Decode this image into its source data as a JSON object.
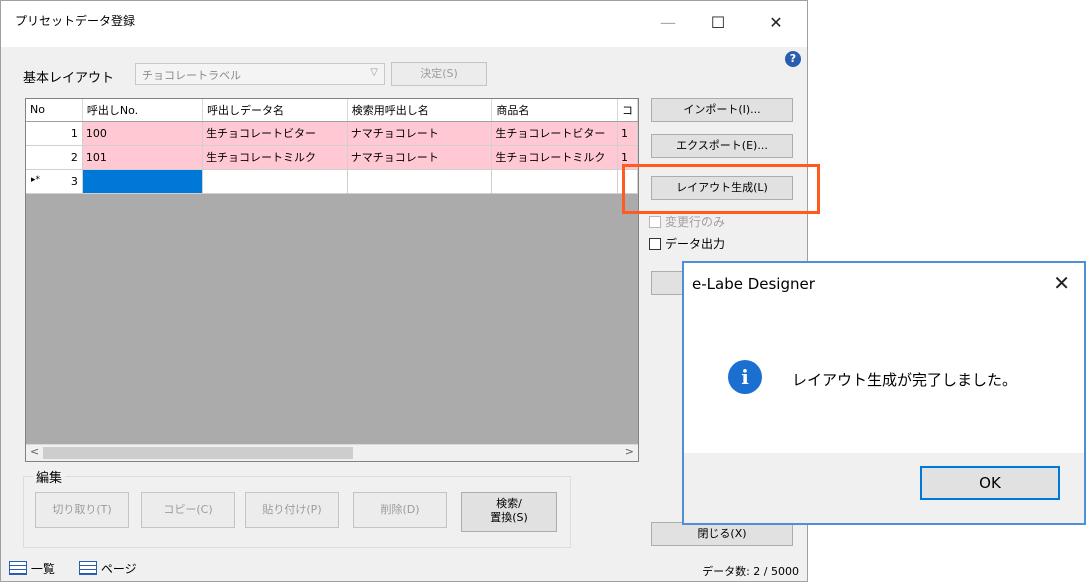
{
  "window": {
    "title": "プリセットデータ登録",
    "minimize": "—",
    "maximize": "☐",
    "close": "✕",
    "help": "?"
  },
  "layout": {
    "label": "基本レイアウト",
    "selected": "チョコレートラベル",
    "decide_button": "決定(S)"
  },
  "grid": {
    "columns": [
      "No",
      "呼出しNo.",
      "呼出しデータ名",
      "検索用呼出し名",
      "商品名",
      "コ"
    ],
    "rows": [
      {
        "marker": "",
        "no": "1",
        "cells": [
          "100",
          "生チョコレートビター",
          "ナマチョコレート",
          "生チョコレートビター",
          "1"
        ]
      },
      {
        "marker": "",
        "no": "2",
        "cells": [
          "101",
          "生チョコレートミルク",
          "ナマチョコレート",
          "生チョコレートミルク",
          "1"
        ]
      },
      {
        "marker": "▸*",
        "no": "3",
        "cells": [
          "",
          "",
          "",
          "",
          ""
        ]
      }
    ],
    "scroll_left": "<",
    "scroll_right": ">"
  },
  "side": {
    "import_button": "インポート(I)...",
    "export_button": "エクスポート(E)...",
    "layout_gen_button": "レイアウト生成(L)",
    "changed_only": "変更行のみ",
    "data_output": "データ出力",
    "close_button": "閉じる(X)"
  },
  "edit": {
    "group_title": "編集",
    "cut": "切り取り(T)",
    "copy": "コピー(C)",
    "paste": "貼り付け(P)",
    "delete": "削除(D)",
    "search_line1": "検索/",
    "search_line2": "置換(S)"
  },
  "status": {
    "tab_list": "一覧",
    "tab_page": "ページ",
    "count": "データ数: 2 / 5000"
  },
  "dialog": {
    "title": "e-Labe Designer",
    "close": "✕",
    "icon": "i",
    "message": "レイアウト生成が完了しました。",
    "ok": "OK"
  },
  "colors": {
    "row_highlight": "#ffc8d2",
    "selected_cell": "#0078d7",
    "annotation": "#ff5a1f",
    "dialog_border": "#4f8fd6"
  }
}
